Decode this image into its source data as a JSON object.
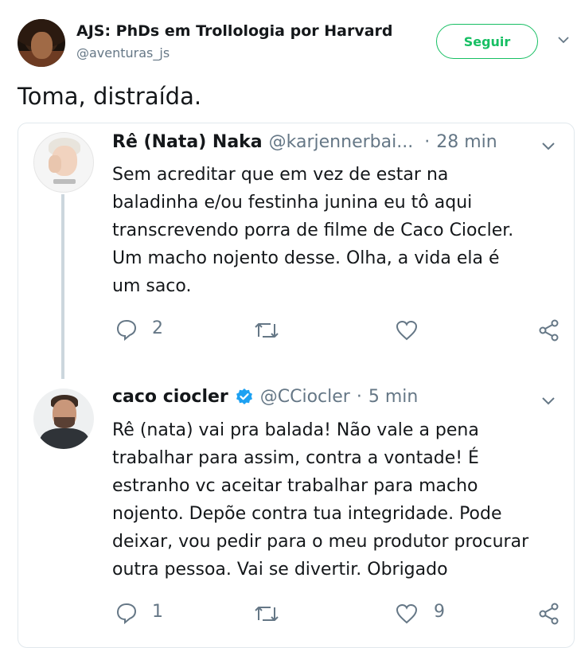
{
  "header": {
    "display_name": "AJS: PhDs em Trollologia por Harvard",
    "handle": "@aventuras_js",
    "follow_label": "Seguir"
  },
  "tweet": {
    "text": "Toma, distraída."
  },
  "quoted": [
    {
      "name": "Rê (Nata) Naka",
      "handle": "@karjennerbai...",
      "separator": "·",
      "time": "28 min",
      "verified": false,
      "body": "Sem acreditar que em vez de estar na\nbaladinha e/ou festinha junina eu tô aqui\ntranscrevendo porra de filme de Caco Ciocler.\nUm macho nojento desse. Olha, a vida ela é\num saco.",
      "replies": "2",
      "retweets": "",
      "likes": ""
    },
    {
      "name": "caco ciocler",
      "handle": "@CCiocler",
      "separator": "·",
      "time": "5 min",
      "verified": true,
      "body": "Rê (nata) vai pra balada! Não vale a pena\ntrabalhar para assim, contra a vontade! É\nestranho vc aceitar trabalhar para macho\nnojento. Depõe contra tua integridade. Pode\ndeixar, vou pedir para o meu produtor procurar\noutra pessoa. Vai se divertir. Obrigado",
      "replies": "1",
      "retweets": "",
      "likes": "9"
    }
  ],
  "icons": {
    "reply": "reply-icon",
    "retweet": "retweet-icon",
    "like": "heart-icon",
    "share": "share-icon",
    "caret": "chevron-down-icon",
    "verified": "verified-badge-icon"
  },
  "colors": {
    "accent": "#17bf63",
    "secondary_text": "#657786",
    "verified": "#1da1f2",
    "border": "#e1e8ed"
  }
}
